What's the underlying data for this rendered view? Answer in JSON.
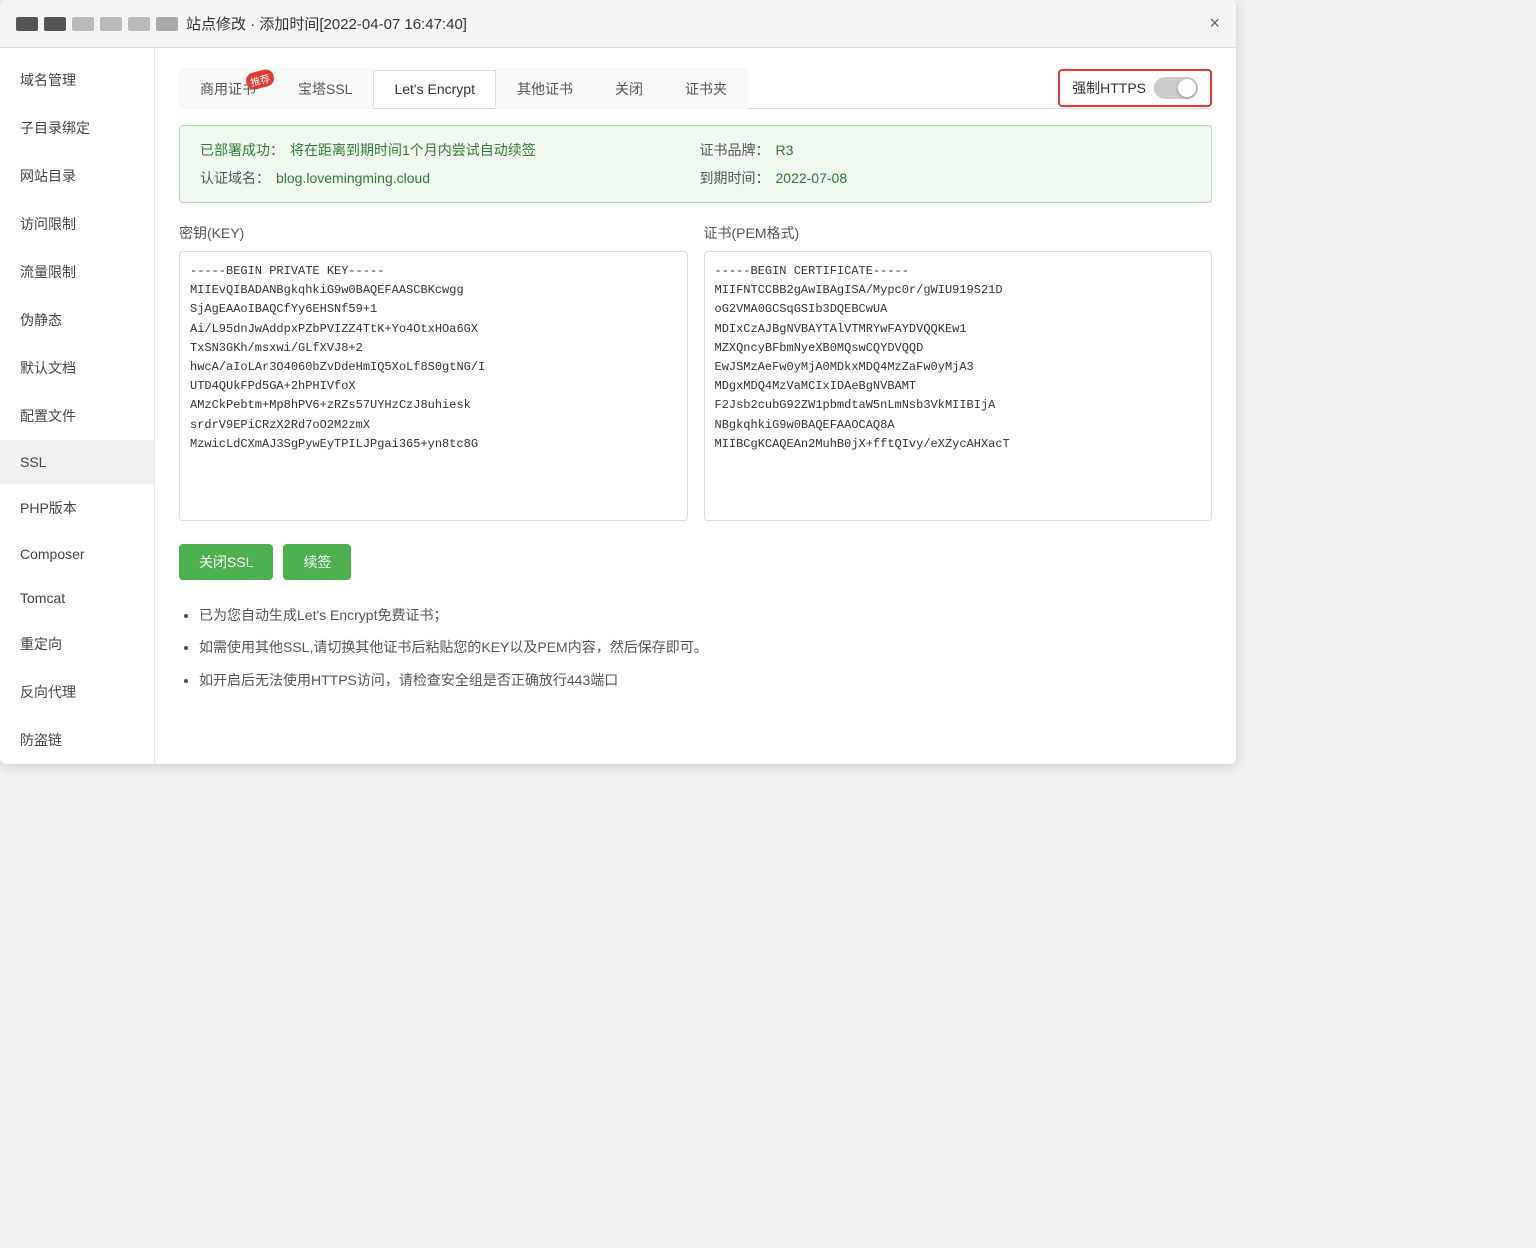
{
  "window": {
    "title": "站点修改",
    "subtitle": "添加时间[2022-04-07 16:47:40]",
    "close_label": "×"
  },
  "sidebar": {
    "items": [
      {
        "id": "domain",
        "label": "域名管理"
      },
      {
        "id": "subdir",
        "label": "子目录绑定"
      },
      {
        "id": "webdir",
        "label": "网站目录"
      },
      {
        "id": "access",
        "label": "访问限制"
      },
      {
        "id": "traffic",
        "label": "流量限制"
      },
      {
        "id": "pseudo",
        "label": "伪静态"
      },
      {
        "id": "default",
        "label": "默认文档"
      },
      {
        "id": "config",
        "label": "配置文件"
      },
      {
        "id": "ssl",
        "label": "SSL",
        "active": true
      },
      {
        "id": "php",
        "label": "PHP版本"
      },
      {
        "id": "composer",
        "label": "Composer"
      },
      {
        "id": "tomcat",
        "label": "Tomcat"
      },
      {
        "id": "redirect",
        "label": "重定向"
      },
      {
        "id": "proxy",
        "label": "反向代理"
      },
      {
        "id": "antichain",
        "label": "防盗链"
      }
    ]
  },
  "tabs": [
    {
      "id": "commercial",
      "label": "商用证书",
      "badge": "推荐"
    },
    {
      "id": "baota",
      "label": "宝塔SSL"
    },
    {
      "id": "letsencrypt",
      "label": "Let's Encrypt",
      "active": true
    },
    {
      "id": "other",
      "label": "其他证书"
    },
    {
      "id": "close",
      "label": "关闭"
    },
    {
      "id": "certfolder",
      "label": "证书夹"
    }
  ],
  "https_toggle": {
    "label": "强制HTTPS"
  },
  "banner": {
    "success_text": "已部署成功：",
    "success_detail": "将在距离到期时间1个月内尝试自动续签",
    "brand_label": "证书品牌：",
    "brand_value": "R3",
    "domain_label": "认证域名：",
    "domain_value": "blog.lovemingming.cloud",
    "expiry_label": "到期时间：",
    "expiry_value": "2022-07-08"
  },
  "key_section": {
    "key_title": "密钥(KEY)",
    "cert_title": "证书(PEM格式)",
    "key_content": "-----BEGIN PRIVATE KEY-----\nMIIEvQIBADANBgkqhkiG9w0BAQEFAASCBKcwgg\nSjAgEAAoIBAQCfYy6EHSNf59+1\nAi/L95dnJwAddpxPZbPVIZZ4TtK+Yo4OtxHOa6GX\nTxSN3GKh/msxwi/GLfXVJ8+2\nhwcA/aIoLAr3O4060bZvDdeHmIQ5XoLf8S0gtNG/I\nUTD4QUkFPd5GA+2hPHIVfoX\nAMzCkPebtm+Mp8hPV6+zRZs57UYHzCzJ8uhiesk\nsrdrV9EPiCRzX2Rd7oO2M2zmX\nMzwicLdCXmAJ3SgPywEyTPILJPgai365+yn8tc8G",
    "cert_content": "-----BEGIN CERTIFICATE-----\nMIIFNTCCBB2gAwIBAgISA/Mypc0r/gWIU919S21D\noG2VMA0GCSqGSIb3DQEBCwUA\nMDIxCzAJBgNVBAYTAlVTMRYwFAYDVQQKEw1\nMZXQncyBFbmNyeXB0MQswCQYDVQQD\nEwJSMzAeFw0yMjA0MDkxMDQ4MzZaFw0yMjA3\nMDgxMDQ4MzVaMCIxIDAeBgNVBAMT\nF2Jsb2cubG92ZW1pbmdtaW5nLmNsb3VkMIIBIjA\nNBgkqhkiG9w0BAQEFAAOCAQ8A\nMIIBCgKCAQEAn2MuhB0jX+fftQIvy/eXZycAHXacT"
  },
  "buttons": {
    "close_ssl": "关闭SSL",
    "renew": "续签"
  },
  "notes": [
    "已为您自动生成Let's Encrypt免费证书；",
    "如需使用其他SSL,请切换其他证书后粘贴您的KEY以及PEM内容，然后保存即可。",
    "如开启后无法使用HTTPS访问，请检查安全组是否正确放行443端口"
  ]
}
